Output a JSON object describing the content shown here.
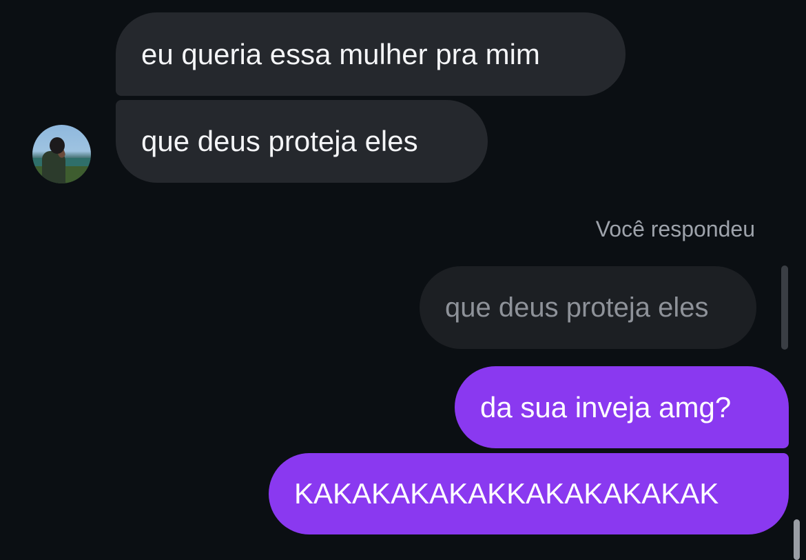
{
  "conversation": {
    "incoming_messages": [
      {
        "text": "eu queria essa mulher pra mim"
      },
      {
        "text": "que deus proteja eles"
      }
    ],
    "reply_label": "Você respondeu",
    "quoted_message": "que deus proteja eles",
    "outgoing_messages": [
      {
        "text": "da sua inveja amg?"
      },
      {
        "text": "KAKAKAKAKAKKAKAKAKAKAK"
      }
    ]
  },
  "colors": {
    "background": "#0b0f13",
    "incoming_bubble": "#25282d",
    "quoted_bubble": "#1c1f23",
    "outgoing_bubble": "#8a39f0"
  },
  "icons": {
    "avatar": "profile-photo"
  }
}
